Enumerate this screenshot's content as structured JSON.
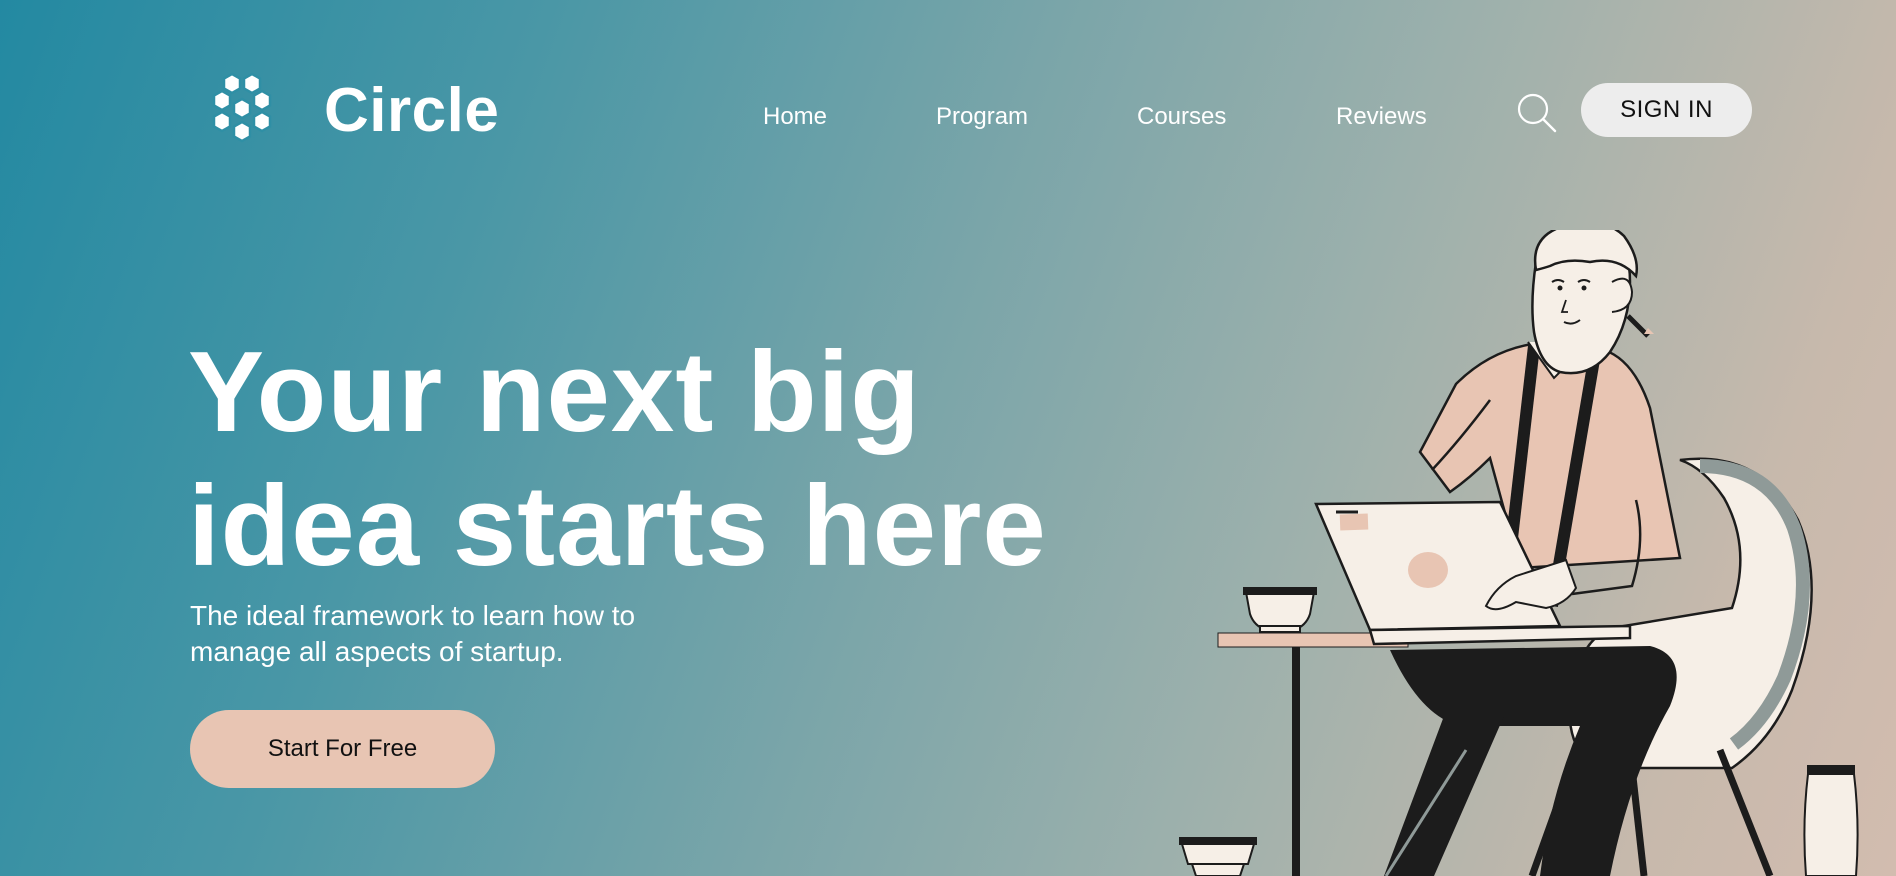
{
  "header": {
    "logo": {
      "text": "Circle",
      "icon": "hexagon-cluster-icon"
    },
    "nav": [
      {
        "label": "Home"
      },
      {
        "label": "Program"
      },
      {
        "label": "Courses"
      },
      {
        "label": "Reviews"
      }
    ],
    "search_icon": "search-icon",
    "signin_label": "SIGN IN"
  },
  "hero": {
    "headline_line1": "Your next big",
    "headline_line2": "idea starts here",
    "subtitle_line1": "The ideal framework to learn how to",
    "subtitle_line2": "manage all aspects of startup.",
    "cta_label": "Start For Free"
  },
  "colors": {
    "gradient_start": "#2389a2",
    "gradient_end": "#d2bcaf",
    "cta_background": "#e8c5b3",
    "signin_background": "#ededed",
    "text": "#ffffff"
  }
}
